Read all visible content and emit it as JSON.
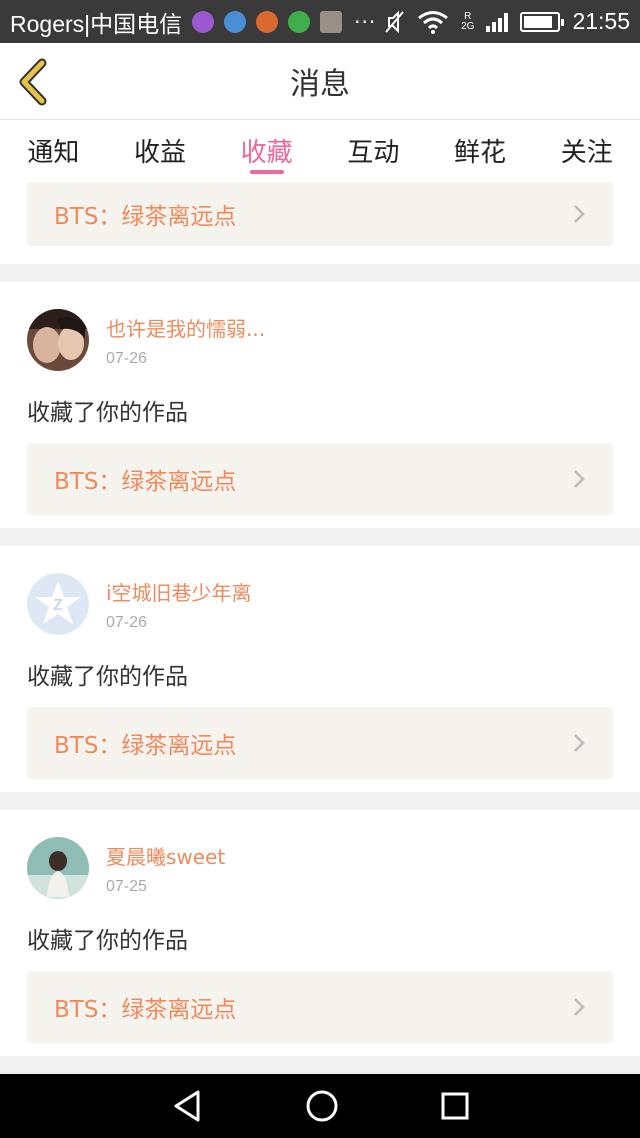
{
  "status_bar": {
    "carrier": "Rogers|中国电信",
    "overflow": "···",
    "network_label": "2G",
    "roaming_label": "R",
    "battery_level": 0.85,
    "time": "21:55"
  },
  "header": {
    "title": "消息",
    "back_icon": "chevron-left-icon"
  },
  "tabs": [
    {
      "label": "通知",
      "active": false
    },
    {
      "label": "收益",
      "active": false
    },
    {
      "label": "收藏",
      "active": true
    },
    {
      "label": "互动",
      "active": false
    },
    {
      "label": "鲜花",
      "active": false
    },
    {
      "label": "关注",
      "active": false
    }
  ],
  "feed": {
    "partial_item": {
      "work_title": "BTS：绿茶离远点"
    },
    "items": [
      {
        "username": "也许是我的懦弱...",
        "date": "07-26",
        "action": "收藏了你的作品",
        "work_title": "BTS：绿茶离远点",
        "avatar": "photo-avatar"
      },
      {
        "username": "i空城旧巷少年离",
        "date": "07-26",
        "action": "收藏了你的作品",
        "work_title": "BTS：绿茶离远点",
        "avatar": "default-star-avatar"
      },
      {
        "username": "夏晨曦sweet",
        "date": "07-25",
        "action": "收藏了你的作品",
        "work_title": "BTS：绿茶离远点",
        "avatar": "photo-avatar"
      }
    ]
  },
  "colors": {
    "accent_pink": "#ea6a9c",
    "username_orange": "#f08a5d",
    "back_arrow_yellow": "#e8c24a",
    "work_box_bg": "#f4f3ee"
  },
  "navbar": {
    "icons": [
      "back-triangle-icon",
      "home-circle-icon",
      "recents-square-icon"
    ]
  }
}
